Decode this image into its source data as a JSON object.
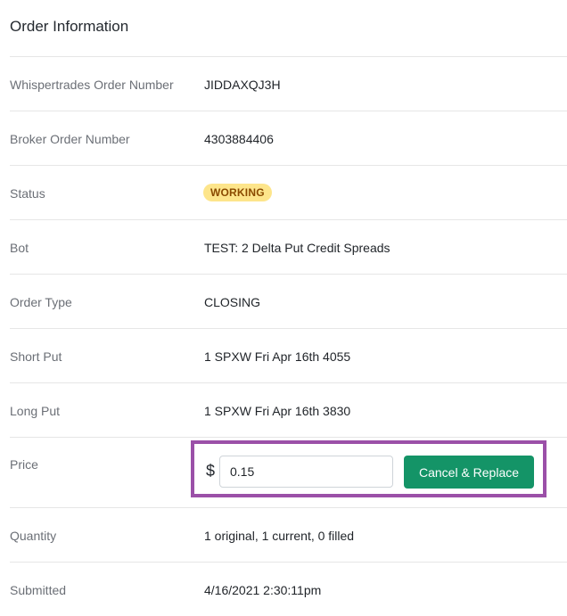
{
  "title": "Order Information",
  "rows": {
    "order_number": {
      "label": "Whispertrades Order Number",
      "value": "JIDDAXQJ3H"
    },
    "broker_number": {
      "label": "Broker Order Number",
      "value": "4303884406"
    },
    "status": {
      "label": "Status",
      "value": "WORKING",
      "badge_color": "#fde58b"
    },
    "bot": {
      "label": "Bot",
      "value": "TEST: 2 Delta Put Credit Spreads",
      "link_color": "#7a55c8"
    },
    "order_type": {
      "label": "Order Type",
      "value": "CLOSING"
    },
    "short_put": {
      "label": "Short Put",
      "value": "1 SPXW Fri Apr 16th 4055"
    },
    "long_put": {
      "label": "Long Put",
      "value": "1 SPXW Fri Apr 16th 3830"
    },
    "price": {
      "label": "Price",
      "currency": "$",
      "input_value": "0.15",
      "button_label": "Cancel & Replace",
      "button_color": "#149467",
      "highlight_color": "#9b50a8"
    },
    "quantity": {
      "label": "Quantity",
      "value": "1 original, 1 current, 0 filled"
    },
    "submitted": {
      "label": "Submitted",
      "value": "4/16/2021 2:30:11pm"
    }
  }
}
